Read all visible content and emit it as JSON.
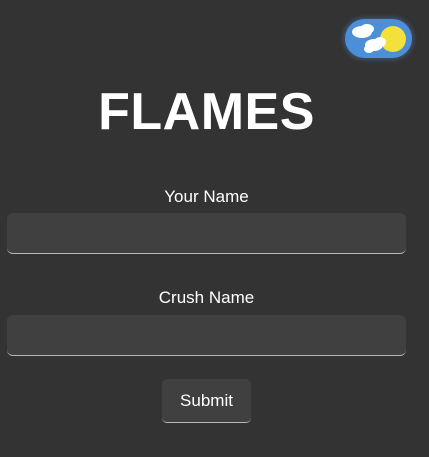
{
  "theme_toggle": {
    "icon": "sun-cloud-icon",
    "mode": "light",
    "colors": {
      "track": "#4a8fd8",
      "sun": "#f3e03a",
      "cloud": "#ffffff"
    }
  },
  "title": "FLAMES",
  "form": {
    "your_name_label": "Your Name",
    "your_name_value": "",
    "crush_name_label": "Crush Name",
    "crush_name_value": "",
    "submit_label": "Submit"
  },
  "colors": {
    "background": "#333333",
    "input_background": "#404040",
    "text": "#ffffff"
  }
}
